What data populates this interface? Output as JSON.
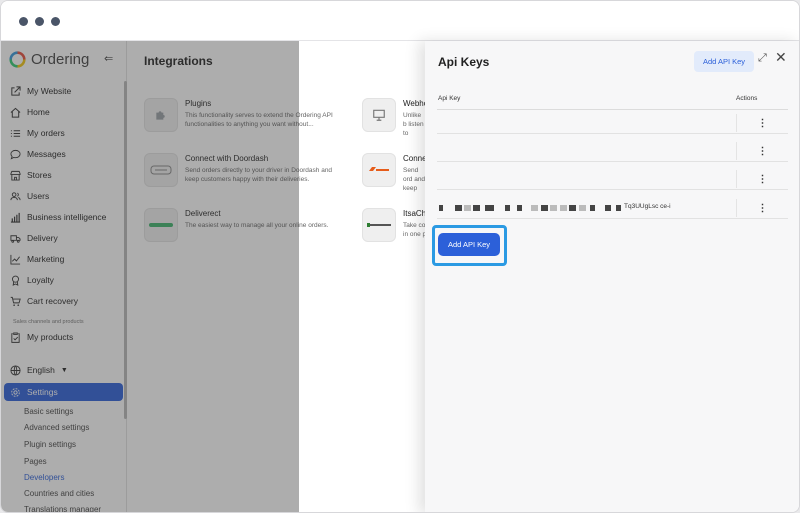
{
  "brand": {
    "name": "Ordering",
    "collapse_icon": "collapse-sidebar-icon"
  },
  "sidebar": {
    "items": [
      {
        "label": "My Website",
        "icon": "external-link-icon"
      },
      {
        "label": "Home",
        "icon": "home-icon"
      },
      {
        "label": "My orders",
        "icon": "list-icon"
      },
      {
        "label": "Messages",
        "icon": "chat-icon"
      },
      {
        "label": "Stores",
        "icon": "store-icon"
      },
      {
        "label": "Users",
        "icon": "users-icon"
      },
      {
        "label": "Business intelligence",
        "icon": "bar-chart-icon"
      },
      {
        "label": "Delivery",
        "icon": "truck-icon"
      },
      {
        "label": "Marketing",
        "icon": "trend-icon"
      },
      {
        "label": "Loyalty",
        "icon": "award-icon"
      },
      {
        "label": "Cart recovery",
        "icon": "cart-icon"
      }
    ],
    "section_label": "Sales channels and products",
    "my_products": "My products",
    "language": "English",
    "settings": "Settings",
    "sub_items": [
      "Basic settings",
      "Advanced settings",
      "Plugin settings",
      "Pages",
      "Developers",
      "Countries and cities",
      "Translations manager"
    ]
  },
  "main": {
    "title": "Integrations",
    "cards": [
      {
        "title": "Plugins",
        "desc": "This functionality serves to extend the Ordering API functionalities to anything you want without...",
        "logo": "puzzle-icon"
      },
      {
        "title": "Webho",
        "desc": "Unlike b listen to",
        "logo": "monitor-icon"
      },
      {
        "title": "Connect with Doordash",
        "desc": "Send orders directly to your driver in Doordash and keep customers happy with their deliveries.",
        "logo": "doordash-logo"
      },
      {
        "title": "Conne",
        "desc": "Send ord and keep",
        "logo": "lalamove-logo"
      },
      {
        "title": "Deliverect",
        "desc": "The easiest way to manage all your online orders.",
        "logo": "deliverect-logo"
      },
      {
        "title": "ItsaCh",
        "desc": "Take co in one p",
        "logo": "itsacheckmate-logo"
      }
    ]
  },
  "panel": {
    "title": "Api Keys",
    "add_top": "Add API Key",
    "col_key": "Api Key",
    "col_actions": "Actions",
    "rows": [
      {
        "key": "",
        "actions": "⋮"
      },
      {
        "key": "",
        "actions": "⋮"
      },
      {
        "key": "",
        "actions": "⋮"
      },
      {
        "key": "Tq3UUgLsc ce-i",
        "actions": "⋮"
      }
    ],
    "add_main": "Add API Key"
  }
}
